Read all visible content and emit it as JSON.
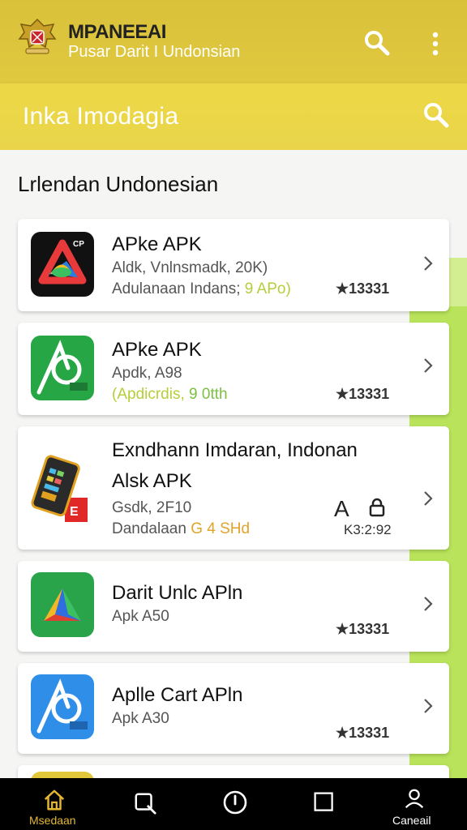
{
  "header": {
    "title": "MPANEEAI",
    "subtitle": "Pusar Darit I Undonsian"
  },
  "search": {
    "text": "Inka Imodagia"
  },
  "section": {
    "title": "Lrlendan Undonesian"
  },
  "apps": [
    {
      "name": "APke APK",
      "meta": "Aldk, Vnlnsmadk, 20K)",
      "info_prefix": "Adulanaan Indans;",
      "info_highlight": "9 APo)",
      "rating": "★13331"
    },
    {
      "name": "APke APK",
      "meta": "Apdk, A98",
      "info_prefix": "(Apdicrdis,",
      "info_highlight": "9 0tth",
      "rating": "★13331"
    },
    {
      "name": "Exndhann Imdaran, Indonan",
      "name2": "Alsk APK",
      "meta": "Gsdk, 2F10",
      "info_prefix": "Dandalaan",
      "info_highlight": "G 4 SHd",
      "rating": "K3:2:92",
      "extra_a": "A",
      "extra_lock": "lock"
    },
    {
      "name": "Darit Unlc APln",
      "meta": "Apk A50",
      "rating": "★13331"
    },
    {
      "name": "Aplle Cart APln",
      "meta": "Apk A30",
      "rating": "★13331"
    }
  ],
  "bottom_nav": [
    {
      "label": "Msedaan",
      "icon": "home-icon",
      "active": true
    },
    {
      "label": "",
      "icon": "search-icon",
      "active": false
    },
    {
      "label": "",
      "icon": "clock-icon",
      "active": false
    },
    {
      "label": "",
      "icon": "square-icon",
      "active": false
    },
    {
      "label": "Caneail",
      "icon": "person-icon",
      "active": false
    }
  ],
  "colors": {
    "appbar": "#dcc43c",
    "searchbar": "#ecd846",
    "nav_active": "#e5b830",
    "accent_green": "#7bc043"
  }
}
